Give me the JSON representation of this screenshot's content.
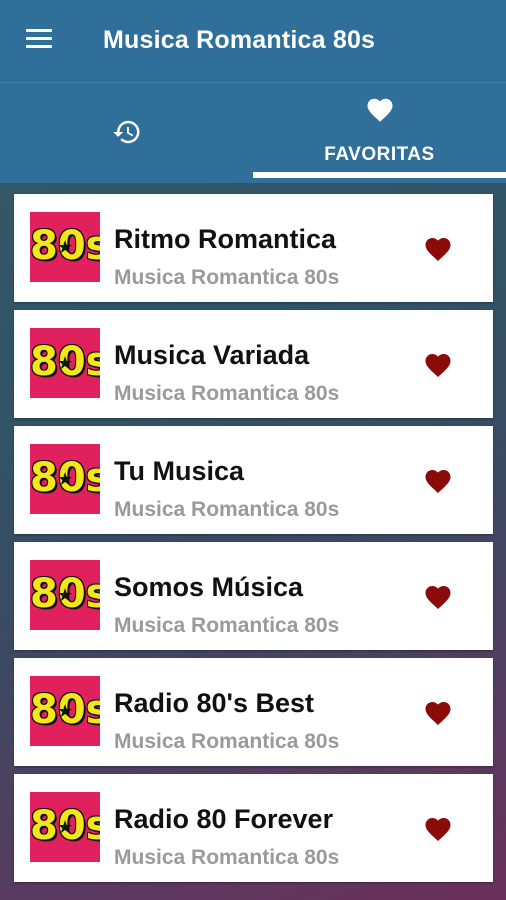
{
  "app": {
    "title": "Musica Romantica 80s"
  },
  "tabs": [
    {
      "label": "",
      "icon": "history-icon",
      "selected": false
    },
    {
      "label": "FAVORITAS",
      "icon": "heart-icon",
      "selected": true
    }
  ],
  "colors": {
    "appbar": "#2f6f9a",
    "heart": "#8b0a0a",
    "thumb_bg": "#e0215e",
    "logo": "#f4e61a"
  },
  "stations": [
    {
      "name": "Ritmo Romantica",
      "subtitle": "Musica Romantica 80s",
      "thumb_text": "80s",
      "favorite": true
    },
    {
      "name": "Musica Variada",
      "subtitle": "Musica Romantica 80s",
      "thumb_text": "80s",
      "favorite": true
    },
    {
      "name": "Tu Musica",
      "subtitle": "Musica Romantica 80s",
      "thumb_text": "80s",
      "favorite": true
    },
    {
      "name": "Somos Música",
      "subtitle": "Musica Romantica 80s",
      "thumb_text": "80s",
      "favorite": true
    },
    {
      "name": "Radio 80's Best",
      "subtitle": "Musica Romantica 80s",
      "thumb_text": "80s",
      "favorite": true
    },
    {
      "name": "Radio 80 Forever",
      "subtitle": "Musica Romantica 80s",
      "thumb_text": "80s",
      "favorite": true
    }
  ]
}
